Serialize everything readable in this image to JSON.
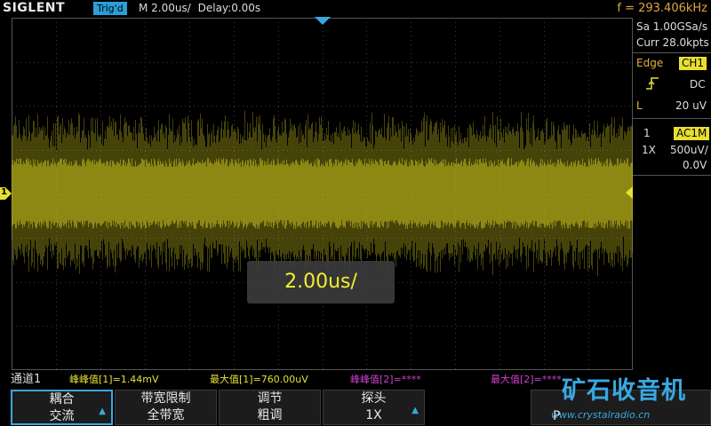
{
  "header": {
    "logo": "SIGLENT",
    "trig_status": "Trig'd",
    "timebase": "M 2.00us/",
    "delay": "Delay:0.00s",
    "frequency": "f = 293.406kHz"
  },
  "acquisition": {
    "sample_rate": "Sa 1.00GSa/s",
    "memory": "Curr 28.0kpts"
  },
  "trigger": {
    "type_label": "Edge",
    "source": "CH1",
    "slope_icon": "rising-edge-icon",
    "coupling": "DC",
    "level_label": "L",
    "level": "20 uV"
  },
  "channel": {
    "number": "1",
    "coupling_badge": "AC1M",
    "probe": "1X",
    "scale": "500uV/",
    "offset": "0.0V"
  },
  "markers": {
    "channel_marker": "1"
  },
  "overlay": {
    "text": "2.00us/"
  },
  "measurements": {
    "channel_label": "通道1",
    "items": [
      {
        "text": "峰峰值[1]=1.44mV"
      },
      {
        "text": "最大值[1]=760.00uV"
      },
      {
        "text": "峰峰值[2]=****"
      },
      {
        "text": "最大值[2]=****"
      }
    ]
  },
  "softkeys": [
    {
      "line1": "耦合",
      "line2": "交流"
    },
    {
      "line1": "带宽限制",
      "line2": "全带宽"
    },
    {
      "line1": "调节",
      "line2": "粗调"
    },
    {
      "line1": "探头",
      "line2": "1X"
    },
    {
      "line1": "",
      "line2": ""
    },
    {
      "line1": "",
      "line2": ""
    }
  ],
  "watermark": {
    "title": "矿石收音机",
    "url": "www.crystalradio.cn",
    "partial_key_text": "P"
  },
  "colors": {
    "trace": "#c9c11e",
    "channel": "#e8e030",
    "accent": "#3aa8e0",
    "frequency": "#e0a640",
    "meas_ch2": "#d040d0"
  }
}
